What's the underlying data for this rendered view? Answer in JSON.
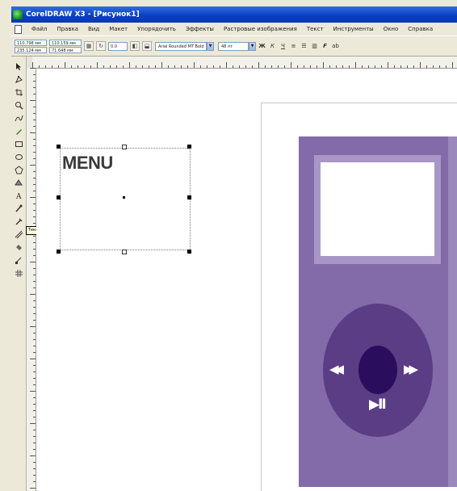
{
  "window": {
    "title": "CorelDRAW X3 - [Рисунок1]"
  },
  "menubar": {
    "items": [
      "Файл",
      "Правка",
      "Вид",
      "Макет",
      "Упорядочить",
      "Эффекты",
      "Растровые изображения",
      "Текст",
      "Инструменты",
      "Окно",
      "Справка"
    ]
  },
  "propbar": {
    "x": "110.798 мм",
    "y": "235.124 мм",
    "width": "110.159 мм",
    "height": "71.648 мм",
    "angle": "0.0",
    "font": "Arial Rounded MT Bold",
    "font_size": "48 пт"
  },
  "tooltip": {
    "text": "Текст (F8)"
  },
  "document": {
    "text_object": "MENU"
  },
  "colors": {
    "titlebar": "#0a3fc4",
    "player_body": "#836aa8",
    "player_bezel": "#a897c6",
    "wheel": "#5b3d86",
    "wheel_center": "#2b0d5e"
  },
  "player": {
    "rewind_icon": "◀◀",
    "forward_icon": "▶▶",
    "play_pause_icon": "▶II"
  }
}
